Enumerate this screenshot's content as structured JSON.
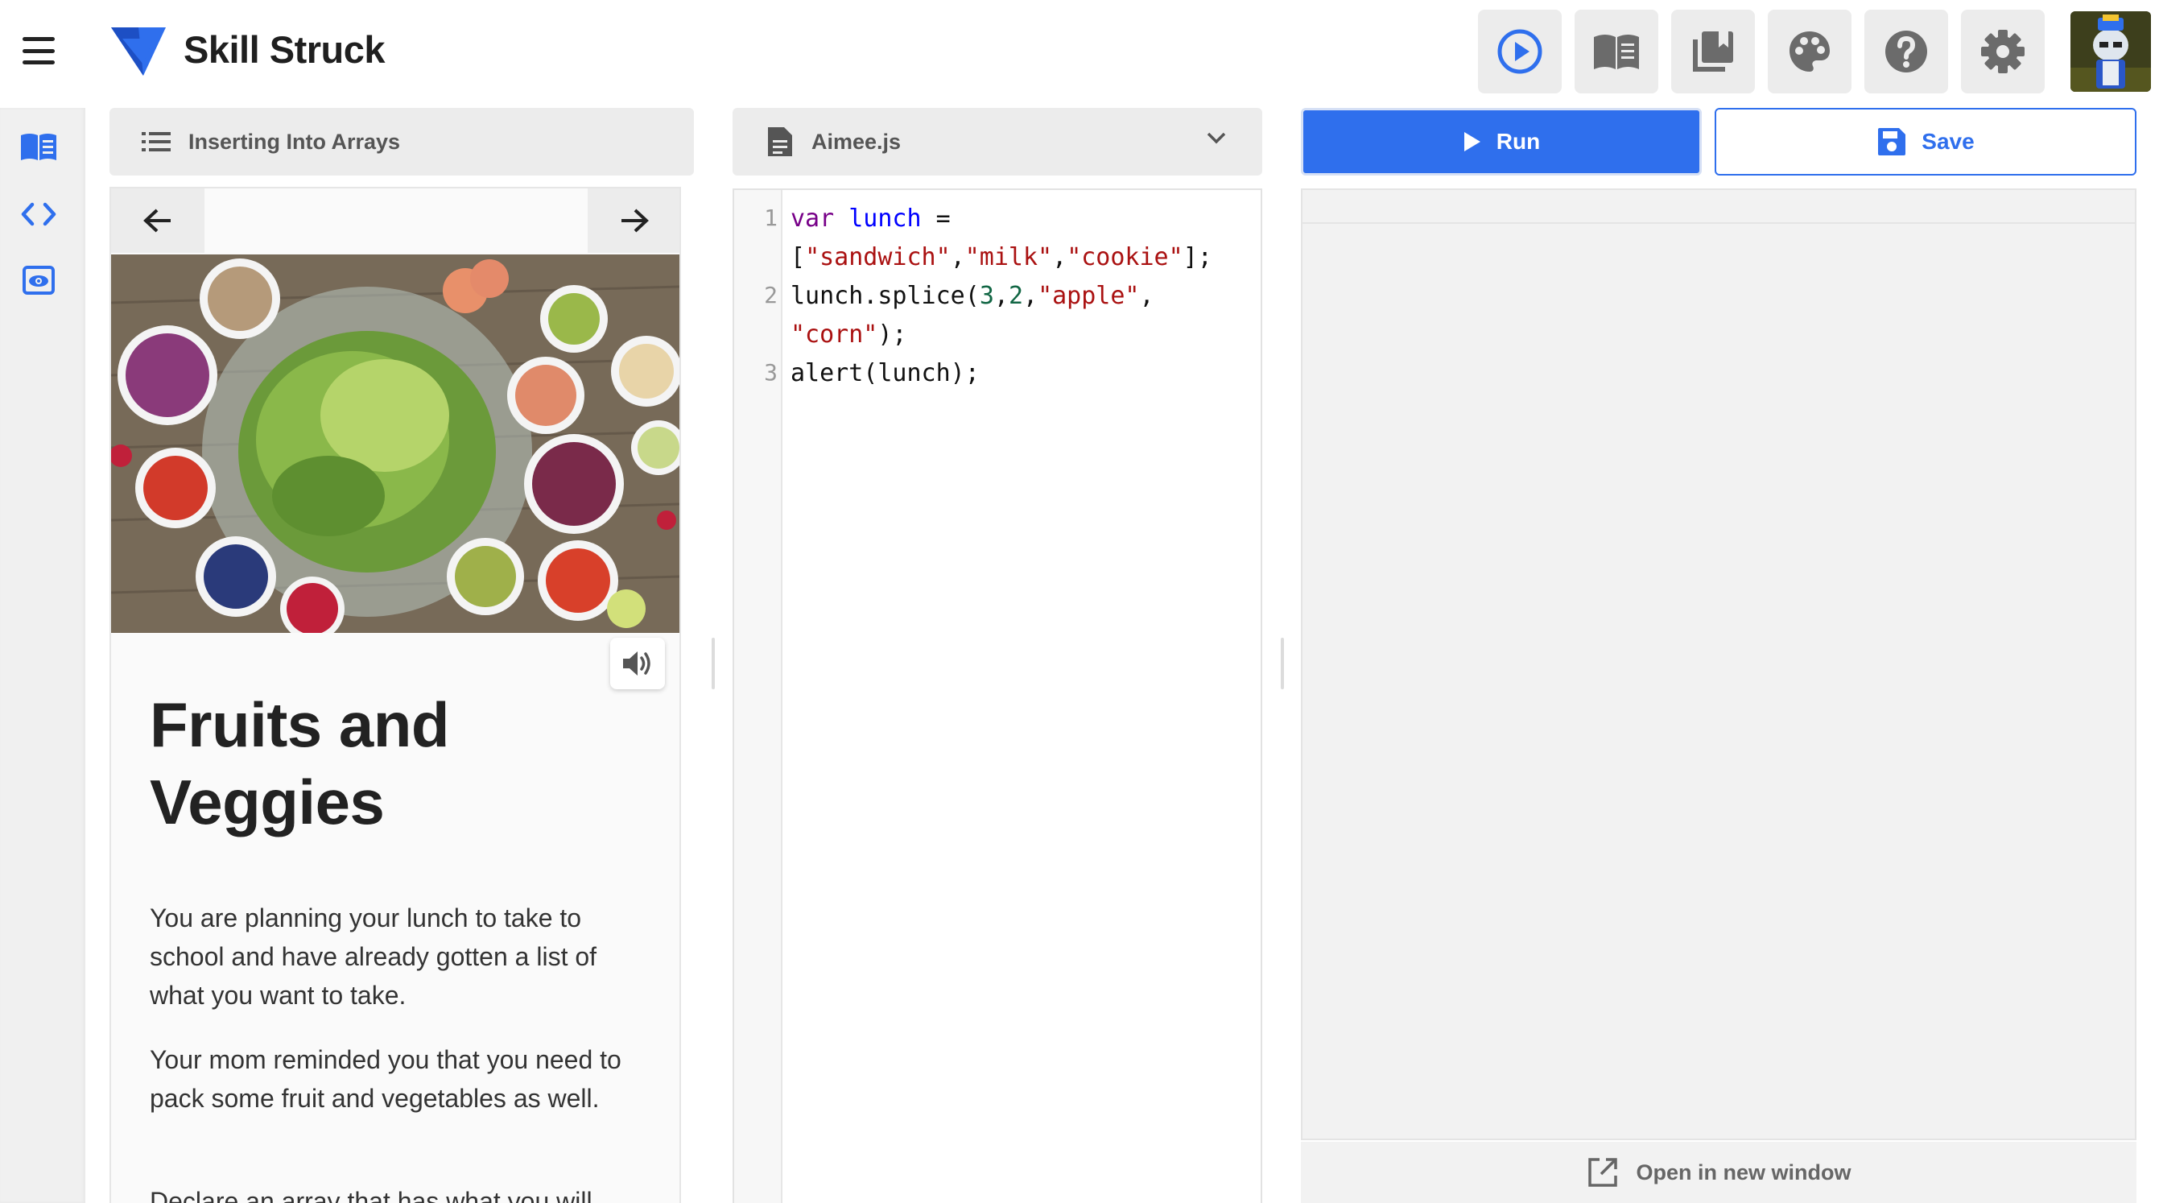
{
  "header": {
    "brand": "Skill Struck",
    "tools": [
      {
        "icon": "play-circle-icon"
      },
      {
        "icon": "book-open-icon"
      },
      {
        "icon": "library-books-icon"
      },
      {
        "icon": "palette-icon"
      },
      {
        "icon": "help-circle-icon"
      },
      {
        "icon": "gear-icon"
      }
    ],
    "avatar": "user-avatar"
  },
  "rail": {
    "items": [
      {
        "icon": "book-open-icon"
      },
      {
        "icon": "code-brackets-icon"
      },
      {
        "icon": "preview-eye-icon"
      }
    ]
  },
  "lesson": {
    "title": "Inserting Into Arrays",
    "heading": "Fruits and Veggies",
    "paragraphs": [
      "You are planning your lunch to take to school and have already gotten a list of what you want to take.",
      "Your mom reminded you that you need to pack some fruit and vegetables as well.",
      "Declare an array that has what you will"
    ]
  },
  "editor": {
    "filename": "Aimee.js",
    "line_numbers": [
      "1",
      "2",
      "3"
    ]
  },
  "output": {
    "run_label": "Run",
    "save_label": "Save",
    "open_new_label": "Open in new window"
  },
  "colors": {
    "accent": "#2f6fed",
    "panel_bg": "#ececec",
    "rail_icon": "#2f6fed"
  }
}
